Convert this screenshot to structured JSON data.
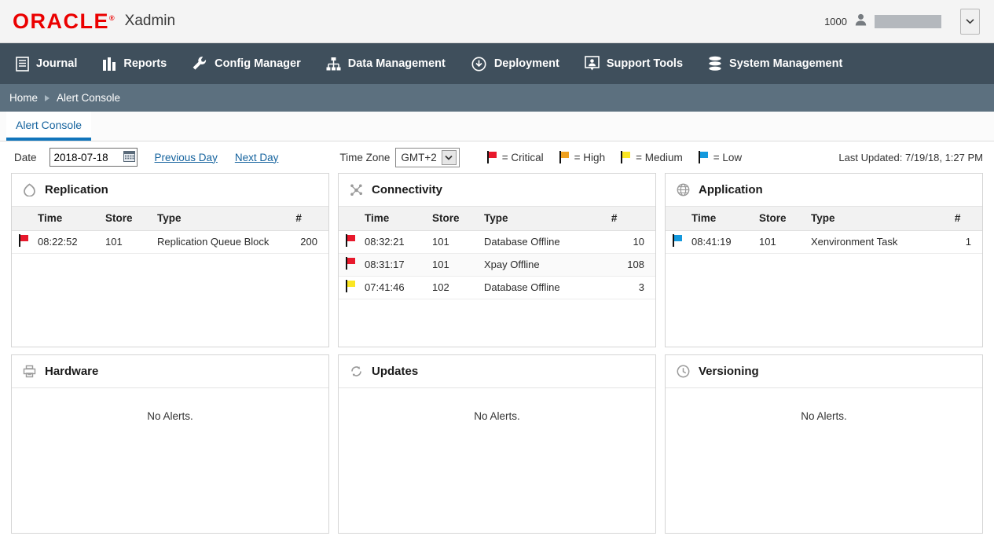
{
  "header": {
    "logo_text": "ORACLE",
    "logo_registered": "®",
    "app_name": "Xadmin",
    "user_id": "1000",
    "user_icon": "person-icon",
    "dropdown_icon": "chevron-down-icon"
  },
  "nav": {
    "items": [
      {
        "label": "Journal",
        "icon": "journal-icon"
      },
      {
        "label": "Reports",
        "icon": "bar-chart-icon"
      },
      {
        "label": "Config Manager",
        "icon": "wrench-icon"
      },
      {
        "label": "Data Management",
        "icon": "sitemap-icon"
      },
      {
        "label": "Deployment",
        "icon": "cloud-download-icon"
      },
      {
        "label": "Support Tools",
        "icon": "support-person-icon"
      },
      {
        "label": "System Management",
        "icon": "database-icon"
      }
    ]
  },
  "breadcrumb": {
    "home": "Home",
    "current": "Alert Console",
    "separator_icon": "triangle-right-icon"
  },
  "tabs": [
    {
      "label": "Alert Console",
      "active": true
    }
  ],
  "toolbar": {
    "date_label": "Date",
    "date_value": "2018-07-18",
    "date_placeholder": "YYYY-MM-DD",
    "calendar_icon": "calendar-icon",
    "previous_day": "Previous Day",
    "next_day": "Next Day",
    "timezone_label": "Time Zone",
    "timezone_value": "GMT+2",
    "timezone_options": [
      "GMT+2"
    ],
    "timezone_icon": "chevron-down-icon",
    "last_updated": "Last Updated: 7/19/18, 1:27 PM",
    "legend": [
      {
        "label": "= Critical",
        "color": "#e8192c"
      },
      {
        "label": "= High",
        "color": "#f0a11e"
      },
      {
        "label": "= Medium",
        "color": "#fbe622"
      },
      {
        "label": "= Low",
        "color": "#1499dd"
      }
    ]
  },
  "table_headers": {
    "time": "Time",
    "store": "Store",
    "type": "Type",
    "count": "#"
  },
  "no_alerts_text": "No Alerts.",
  "panels": [
    {
      "title": "Replication",
      "icon": "replication-cycle-icon",
      "rows": [
        {
          "severity_color": "#e8192c",
          "severity": "Critical",
          "time": "08:22:52",
          "store": "101",
          "type": "Replication Queue Block",
          "count": "200"
        }
      ]
    },
    {
      "title": "Connectivity",
      "icon": "network-nodes-icon",
      "rows": [
        {
          "severity_color": "#e8192c",
          "severity": "Critical",
          "time": "08:32:21",
          "store": "101",
          "type": "Database Offline",
          "count": "10"
        },
        {
          "severity_color": "#e8192c",
          "severity": "Critical",
          "time": "08:31:17",
          "store": "101",
          "type": "Xpay Offline",
          "count": "108"
        },
        {
          "severity_color": "#fbe622",
          "severity": "Medium",
          "time": "07:41:46",
          "store": "102",
          "type": "Database Offline",
          "count": "3"
        }
      ]
    },
    {
      "title": "Application",
      "icon": "globe-icon",
      "rows": [
        {
          "severity_color": "#1499dd",
          "severity": "Low",
          "time": "08:41:19",
          "store": "101",
          "type": "Xenvironment Task",
          "count": "1"
        }
      ]
    },
    {
      "title": "Hardware",
      "icon": "printer-icon",
      "rows": []
    },
    {
      "title": "Updates",
      "icon": "sync-arrows-icon",
      "rows": []
    },
    {
      "title": "Versioning",
      "icon": "clock-icon",
      "rows": []
    }
  ]
}
